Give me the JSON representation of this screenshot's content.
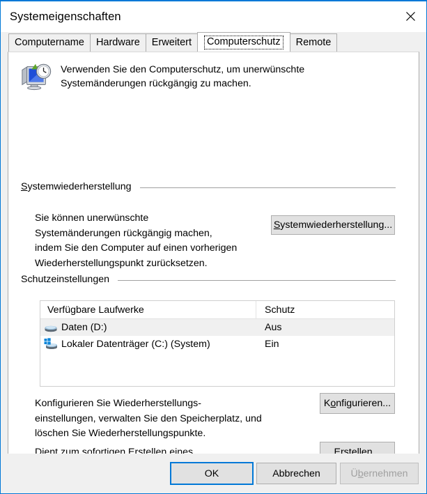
{
  "window": {
    "title": "Systemeigenschaften",
    "close_icon": "close-icon"
  },
  "tabs": [
    {
      "label": "Computername",
      "selected": false
    },
    {
      "label": "Hardware",
      "selected": false
    },
    {
      "label": "Erweitert",
      "selected": false
    },
    {
      "label": "Computerschutz",
      "selected": true
    },
    {
      "label": "Remote",
      "selected": false
    }
  ],
  "intro": {
    "icon": "system-restore-icon",
    "text": "Verwenden Sie den Computerschutz, um unerwünschte\nSystemänderungen rückgängig zu machen."
  },
  "system_restore": {
    "group_label": "Systemwiederherstellung",
    "group_label_accel": "S",
    "group_label_rest": "ystemwiederherstellung",
    "description": "Sie können unerwünschte\nSystemänderungen rückgängig machen,\nindem Sie den Computer auf einen vorherigen\nWiederherstellungspunkt zurücksetzen.",
    "button_accel": "S",
    "button_rest": "ystemwiederherstellung..."
  },
  "protection_settings": {
    "group_label": "Schutzeinstellungen",
    "table": {
      "columns": [
        "Verfügbare Laufwerke",
        "Schutz"
      ],
      "rows": [
        {
          "icon": "drive-icon",
          "name": "Daten (D:)",
          "protection": "Aus",
          "selected": true
        },
        {
          "icon": "system-drive-icon",
          "name": "Lokaler Datenträger (C:) (System)",
          "protection": "Ein",
          "selected": false
        }
      ]
    },
    "configure_description": "Konfigurieren Sie Wiederherstellungs-\neinstellungen, verwalten Sie den Speicherplatz, und\nlöschen Sie Wiederherstellungspunkte.",
    "configure_button_pre": "K",
    "configure_button_accel": "o",
    "configure_button_rest": "nfigurieren...",
    "create_description": "Dient zum sofortigen Erstellen eines\nWiederherstellungspunkts für die Laufwerke mit\naktiviertem Systemschutz.",
    "create_button_accel": "E",
    "create_button_rest": "rstellen..."
  },
  "dialog_buttons": {
    "ok": "OK",
    "cancel": "Abbrechen",
    "apply_pre": "Ü",
    "apply_accel": "b",
    "apply_rest": "ernehmen",
    "apply_disabled": true
  },
  "colors": {
    "accent": "#0078d7",
    "dialog_bg": "#f0f0f0",
    "panel_bg": "#ffffff",
    "button_face": "#e1e1e1",
    "button_border": "#adadad",
    "separator": "#a0a0a0",
    "row_selected": "#f0f0f0"
  }
}
